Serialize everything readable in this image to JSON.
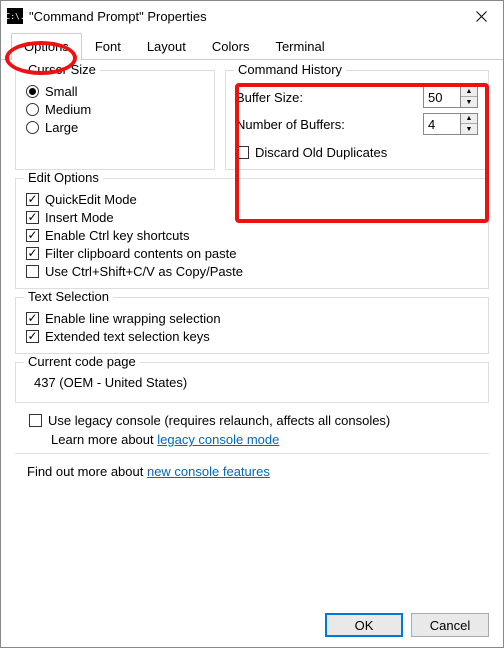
{
  "title": "\"Command Prompt\" Properties",
  "tb_icon_text": "C:\\.",
  "tabs": {
    "options": "Options",
    "font": "Font",
    "layout": "Layout",
    "colors": "Colors",
    "terminal": "Terminal"
  },
  "cursor": {
    "legend": "Cursor Size",
    "small": "Small",
    "medium": "Medium",
    "large": "Large"
  },
  "history": {
    "legend": "Command History",
    "buffer": "Buffer Size:",
    "buffer_v": "50",
    "numbuf": "Number of Buffers:",
    "numbuf_v": "4",
    "discard": "Discard Old Duplicates"
  },
  "edit": {
    "legend": "Edit Options",
    "quick": "QuickEdit Mode",
    "insert": "Insert Mode",
    "ctrl": "Enable Ctrl key shortcuts",
    "filter": "Filter clipboard contents on paste",
    "ctrlshift": "Use Ctrl+Shift+C/V as Copy/Paste"
  },
  "text": {
    "legend": "Text Selection",
    "wrap": "Enable line wrapping selection",
    "ext": "Extended text selection keys"
  },
  "codepage": {
    "legend": "Current code page",
    "value": "437   (OEM - United States)"
  },
  "legacy": {
    "label": "Use legacy console (requires relaunch, affects all consoles)",
    "learn": "Learn more about ",
    "link": "legacy console mode"
  },
  "more": {
    "pre": "Find out more about ",
    "link": "new console features"
  },
  "buttons": {
    "ok": "OK",
    "cancel": "Cancel"
  },
  "glyph": {
    "up": "▲",
    "down": "▼"
  }
}
